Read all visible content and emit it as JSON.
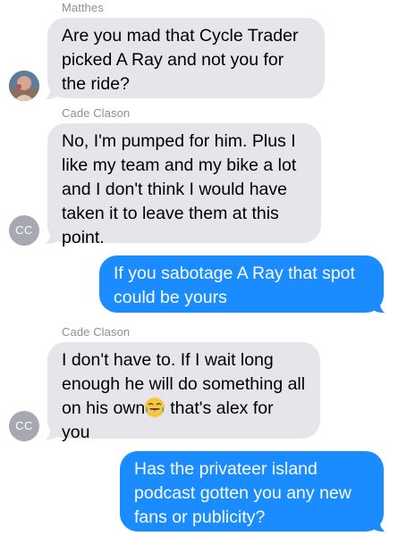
{
  "contacts": {
    "matthes": {
      "name": "Matthes"
    },
    "cade": {
      "name": "Cade Clason",
      "initials": "CC"
    }
  },
  "messages": [
    {
      "direction": "incoming",
      "sender": "Matthes",
      "lines": [
        "Are you mad that Cycle Trader",
        "picked A Ray and not you for",
        "the ride?"
      ]
    },
    {
      "direction": "incoming",
      "sender": "Cade Clason",
      "lines": [
        "No, I'm pumped for him. Plus I",
        "like my team and my bike a lot",
        "and I don't think I would have",
        "taken it to leave them at this",
        "point."
      ]
    },
    {
      "direction": "outgoing",
      "lines": [
        "If you sabotage A Ray that spot",
        "could be yours"
      ]
    },
    {
      "direction": "incoming",
      "sender": "Cade Clason",
      "lines": [
        "I don't have to. If I wait long",
        "enough he will do something all",
        "on his own",
        "that's alex for",
        "you"
      ],
      "emoji": "joy-emoji"
    },
    {
      "direction": "outgoing",
      "lines": [
        "Has the privateer island",
        "podcast gotten you any new",
        "fans or publicity?"
      ]
    }
  ],
  "colors": {
    "incoming_bubble": "#e5e5ea",
    "outgoing_bubble": "#1a8cff",
    "sender_label": "#8e8e93",
    "avatar_initials_bg": "#a7a9b0"
  }
}
